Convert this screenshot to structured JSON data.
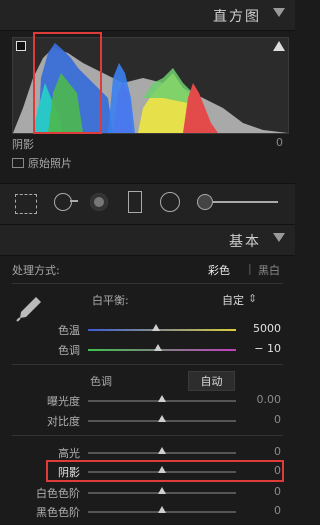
{
  "histogram": {
    "title": "直方图",
    "shadow_label": "阴影",
    "shadow_value": "0",
    "original_photo_label": "原始照片"
  },
  "tools": {
    "items": [
      "crop-overlay-icon",
      "spot-removal-icon",
      "red-eye-icon",
      "graduated-filter-icon",
      "radial-filter-icon",
      "adjustment-brush-icon"
    ]
  },
  "basic": {
    "title": "基本",
    "treatment_label": "处理方式:",
    "color_option": "彩色",
    "separator": "|",
    "bw_option": "黑白",
    "wb_label": "白平衡:",
    "wb_value": "自定",
    "wb_arrows": "⇕",
    "temp_label": "色温",
    "temp_value": "5000",
    "temp_pos": 0.46,
    "tint_label": "色调",
    "tint_value": "− 10",
    "tint_pos": 0.47,
    "tone_label": "色调",
    "auto_label": "自动",
    "exposure_label": "曝光度",
    "exposure_value": "0.00",
    "exposure_pos": 0.5,
    "contrast_label": "对比度",
    "contrast_value": "0",
    "contrast_pos": 0.5,
    "highlights_label": "高光",
    "highlights_value": "0",
    "highlights_pos": 0.5,
    "shadows_label": "阴影",
    "shadows_value": "0",
    "shadows_pos": 0.5,
    "whites_label": "白色色阶",
    "whites_value": "0",
    "whites_pos": 0.5,
    "blacks_label": "黑色色阶",
    "blacks_value": "0",
    "blacks_pos": 0.5
  },
  "colors": {
    "highlight_box": "#e03b3b",
    "temp_gradient_start": "#3d5bd6",
    "temp_gradient_end": "#d9cc3a",
    "tint_gradient_start": "#3fc24a",
    "tint_gradient_end": "#c23fc0"
  }
}
